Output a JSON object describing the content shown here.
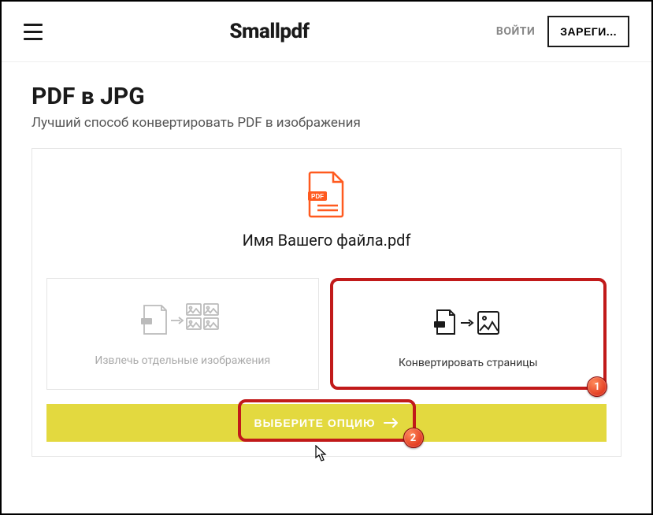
{
  "header": {
    "logo": "Smallpdf",
    "login": "ВОЙТИ",
    "register": "ЗАРЕГИ..."
  },
  "page": {
    "title": "PDF в JPG",
    "subtitle": "Лучший способ конвертировать PDF в изображения"
  },
  "file": {
    "name": "Имя Вашего файла.pdf"
  },
  "options": {
    "extract": "Извлечь отдельные изображения",
    "convert": "Конвертировать страницы"
  },
  "cta": {
    "label": "ВЫБЕРИТЕ ОПЦИЮ"
  },
  "badges": {
    "one": "1",
    "two": "2"
  }
}
